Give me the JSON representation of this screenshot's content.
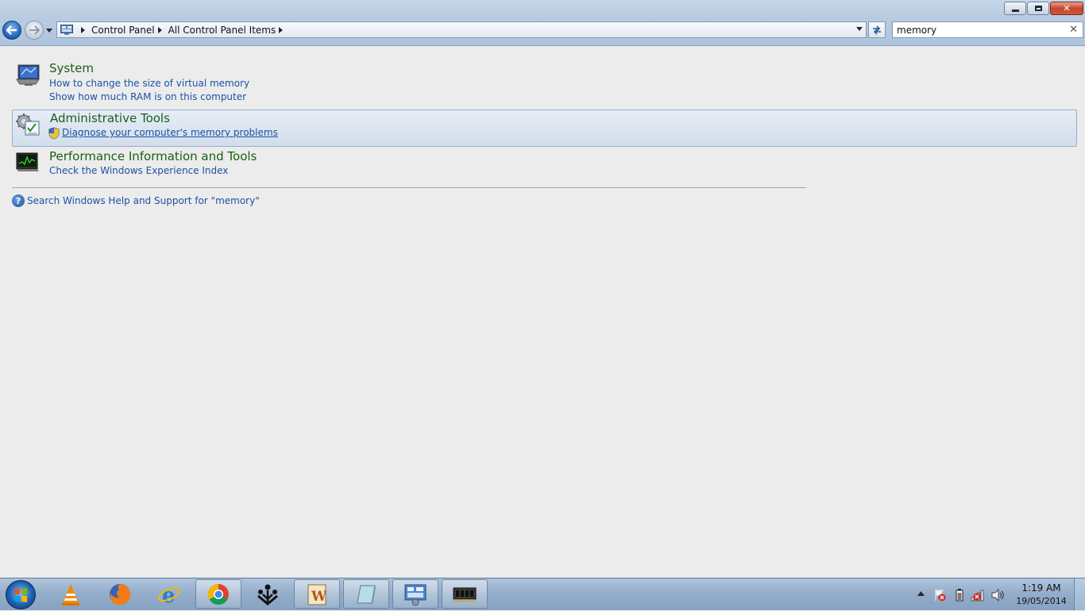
{
  "window": {
    "minimize_label": "minimize",
    "maximize_label": "restore",
    "close_label": "close"
  },
  "address": {
    "breadcrumbs": [
      "Control Panel",
      "All Control Panel Items"
    ]
  },
  "search": {
    "value": "memory",
    "clear_glyph": "✕"
  },
  "results": [
    {
      "title": "System",
      "icon": "system-monitor-icon",
      "tasks": [
        "How to change the size of virtual memory",
        "Show how much RAM is on this computer"
      ]
    },
    {
      "title": "Administrative Tools",
      "icon": "admin-tools-icon",
      "selected": true,
      "tasks": [
        "Diagnose your computer's memory problems"
      ]
    },
    {
      "title": "Performance Information and Tools",
      "icon": "performance-icon",
      "tasks": [
        "Check the Windows Experience Index"
      ]
    }
  ],
  "help": {
    "text": "Search Windows Help and Support for \"memory\"",
    "icon_glyph": "?"
  },
  "taskbar": {
    "pinned": [
      "vlc-icon",
      "firefox-icon",
      "internet-explorer-icon",
      "chrome-icon",
      "network-app-icon",
      "word-icon",
      "notes-app-icon",
      "control-panel-icon",
      "memory-chip-icon"
    ],
    "clock_time": "1:19 AM",
    "clock_date": "19/05/2014"
  },
  "colors": {
    "title_green": "#1a5e17",
    "link_blue": "#1c52a3",
    "selection_border": "#95aecd"
  }
}
